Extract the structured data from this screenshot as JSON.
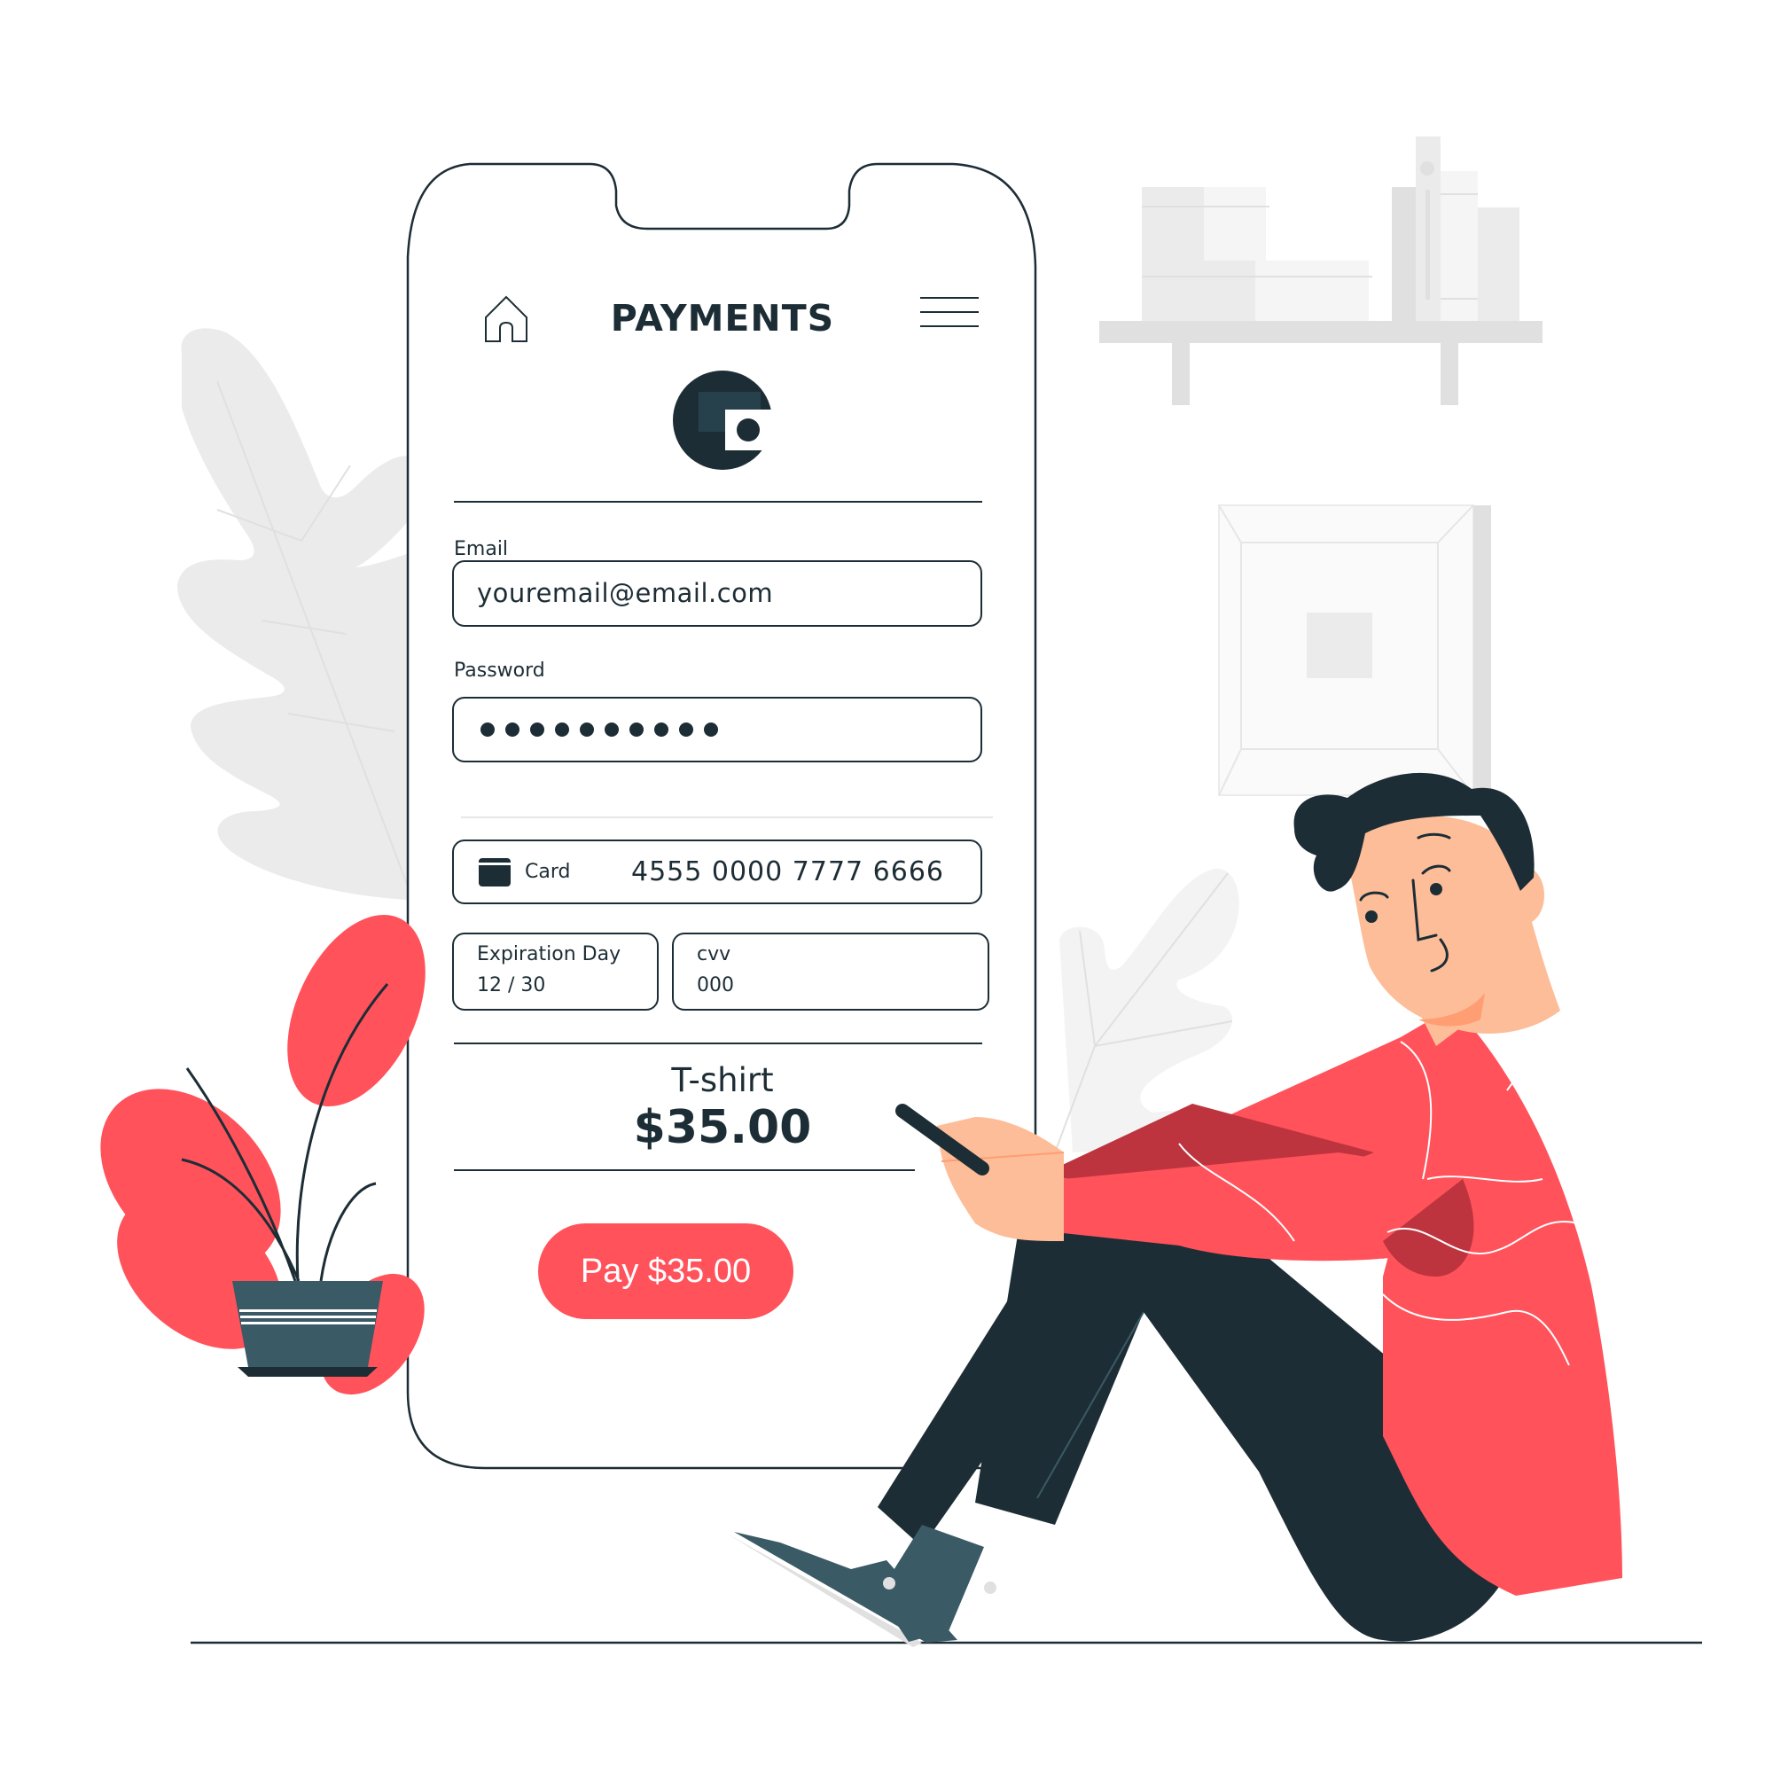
{
  "colors": {
    "accent": "#ff525b",
    "accent_dark": "#bd333e",
    "ink": "#1d2d35",
    "pot": "#3a5a66",
    "skin": "#fdbd98",
    "skin_shadow": "#ff9d73",
    "background_gray": "#ebebeb"
  },
  "phone": {
    "header": {
      "title": "PAYMENTS",
      "home_icon": "home-icon",
      "menu_icon": "hamburger-menu-icon"
    },
    "wallet_icon": "wallet-icon",
    "form": {
      "email": {
        "label": "Email",
        "value": "youremail@email.com"
      },
      "password": {
        "label": "Password",
        "masked_length": 10
      },
      "card": {
        "icon": "credit-card-icon",
        "label": "Card",
        "number": "4555 0000 7777 6666"
      },
      "expiration": {
        "label": "Expiration Day",
        "value": "12 / 30"
      },
      "cvv": {
        "label": "cvv",
        "value": "000"
      }
    },
    "summary": {
      "item": "T-shirt",
      "price": "$35.00"
    },
    "pay_button": {
      "label": "Pay $35.00"
    }
  },
  "scene": {
    "character": "person-sitting-with-phone",
    "plant": "potted-plant",
    "shelf": "wall-shelf-with-boxes-and-books",
    "frame": "wall-picture-frame"
  }
}
